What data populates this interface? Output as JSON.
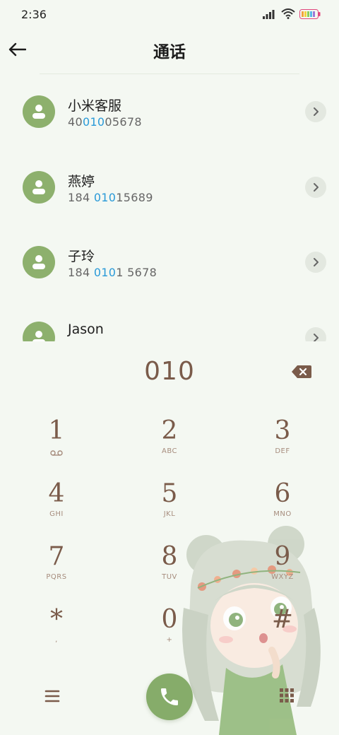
{
  "status": {
    "time": "2:36"
  },
  "header": {
    "title": "通话"
  },
  "contacts": [
    {
      "name": "小米客服",
      "number_parts": [
        "40",
        "010",
        "05678"
      ],
      "hl_index": 1
    },
    {
      "name": "燕婷",
      "number_parts": [
        "184 ",
        "010",
        "15689"
      ],
      "hl_index": 1
    },
    {
      "name": "子玲",
      "number_parts": [
        "184 ",
        "010",
        "1 5678"
      ],
      "hl_index": 1
    },
    {
      "name": "Jason",
      "number_parts": [
        "",
        "",
        ""
      ],
      "hl_index": 1
    }
  ],
  "dialer": {
    "input": "010"
  },
  "keys": [
    {
      "digit": "1",
      "letters": ""
    },
    {
      "digit": "2",
      "letters": "ABC"
    },
    {
      "digit": "3",
      "letters": "DEF"
    },
    {
      "digit": "4",
      "letters": "GHI"
    },
    {
      "digit": "5",
      "letters": "JKL"
    },
    {
      "digit": "6",
      "letters": "MNO"
    },
    {
      "digit": "7",
      "letters": "PQRS"
    },
    {
      "digit": "8",
      "letters": "TUV"
    },
    {
      "digit": "9",
      "letters": "WXYZ"
    },
    {
      "digit": "*",
      "letters": ","
    },
    {
      "digit": "0",
      "letters": "+"
    },
    {
      "digit": "#",
      "letters": ""
    }
  ],
  "icons": {
    "back": "arrow-left-icon",
    "detail": "chevron-right-icon",
    "delete": "backspace-icon",
    "voicemail": "voicemail-icon",
    "call": "phone-icon",
    "menu": "menu-icon",
    "keypad": "keypad-icon"
  },
  "colors": {
    "background": "#f4f8f2",
    "accent_green": "#86ac6a",
    "digit_brown": "#7a5b4a",
    "highlight_blue": "#2a9ad8"
  }
}
